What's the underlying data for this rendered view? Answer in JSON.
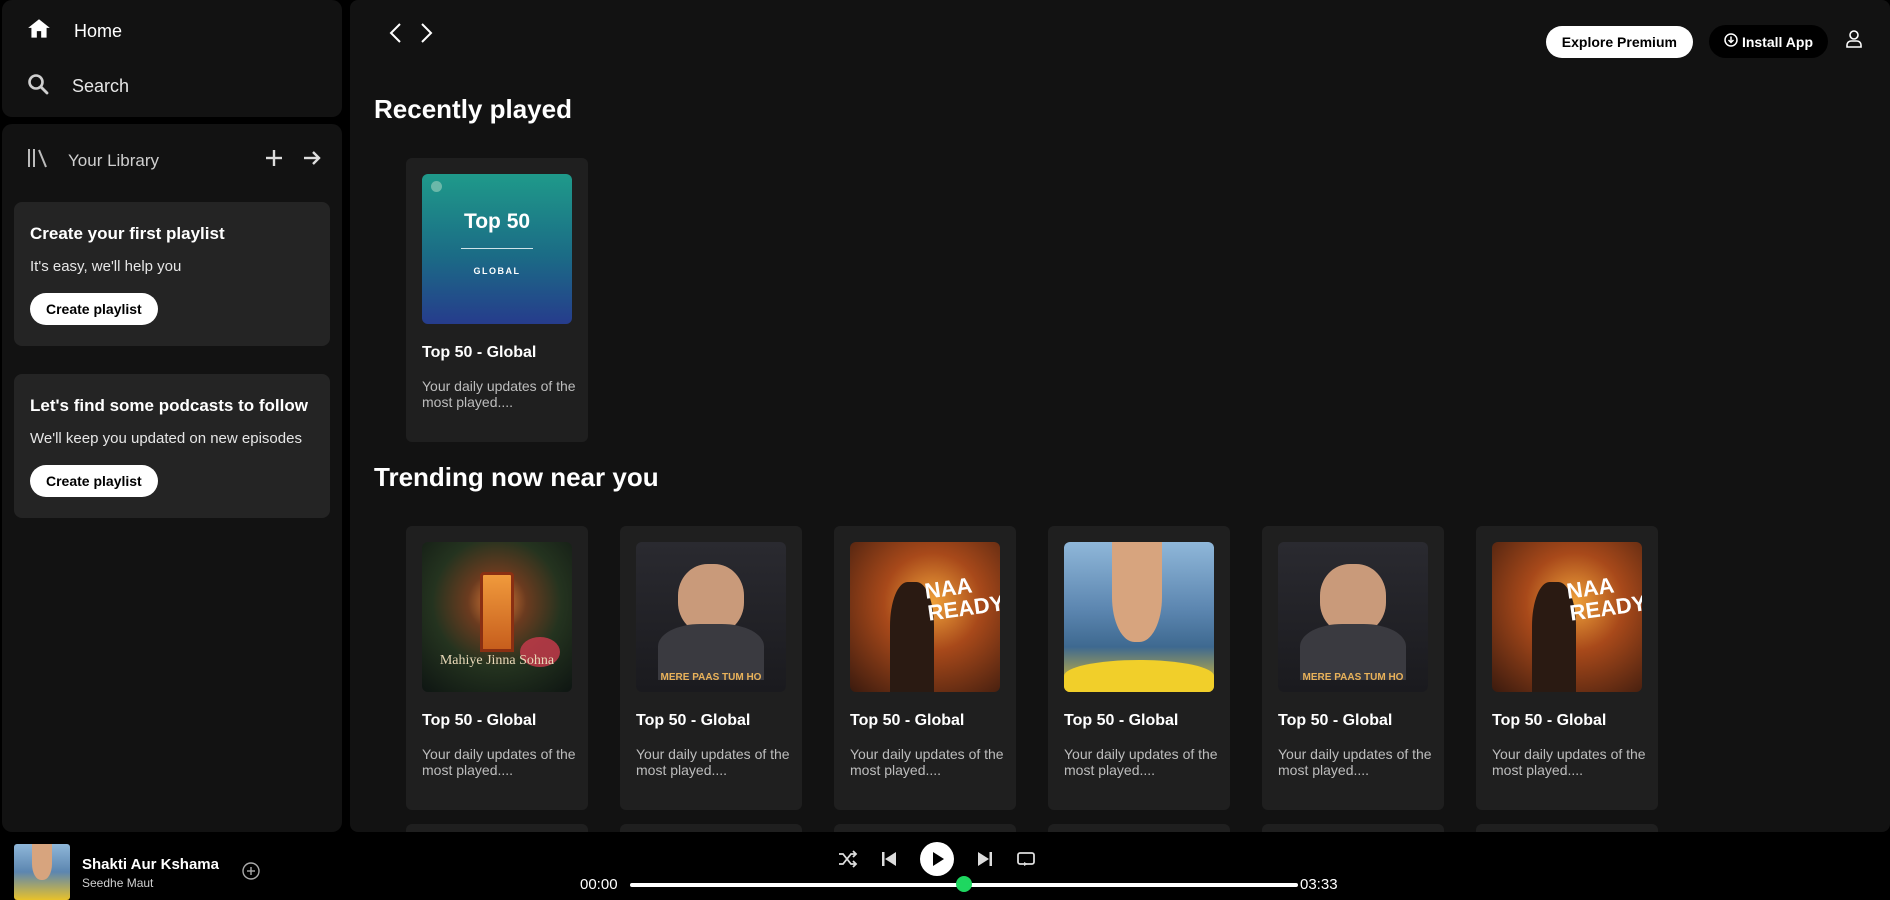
{
  "nav": {
    "home": "Home",
    "search": "Search"
  },
  "library": {
    "title": "Your Library",
    "cards": [
      {
        "title": "Create your first playlist",
        "subtitle": "It's easy, we'll help you",
        "button": "Create playlist"
      },
      {
        "title": "Let's find some podcasts to follow",
        "subtitle": "We'll keep you updated on new episodes",
        "button": "Create playlist"
      }
    ]
  },
  "topbar": {
    "explore": "Explore Premium",
    "install": "Install App"
  },
  "recently": {
    "title": "Recently played",
    "items": [
      {
        "name": "Top 50 - Global",
        "desc": "Your daily updates of the most played....",
        "art": {
          "headline": "Top 50",
          "sub": "GLOBAL"
        }
      }
    ]
  },
  "trending": {
    "title": "Trending now near you",
    "items": [
      {
        "name": "Top 50 - Global",
        "desc": "Your daily updates of the most played....",
        "art_label": "Mahiye Jinna Sohna"
      },
      {
        "name": "Top 50 - Global",
        "desc": "Your daily updates of the most played....",
        "art_label": "MERE PAAS TUM HO"
      },
      {
        "name": "Top 50 - Global",
        "desc": "Your daily updates of the most played....",
        "art_label": "NAA READY"
      },
      {
        "name": "Top 50 - Global",
        "desc": "Your daily updates of the most played....",
        "art_label": ""
      },
      {
        "name": "Top 50 - Global",
        "desc": "Your daily updates of the most played....",
        "art_label": "MERE PAAS TUM HO"
      },
      {
        "name": "Top 50 - Global",
        "desc": "Your daily updates of the most played....",
        "art_label": "NAA READY"
      }
    ]
  },
  "player": {
    "title": "Shakti Aur Kshama",
    "artist": "Seedhe Maut",
    "elapsed": "00:00",
    "duration": "03:33",
    "progress_fraction": 0.5
  },
  "colors": {
    "accent": "#1ed760",
    "surface": "#121212",
    "card": "#1f1f1f"
  }
}
